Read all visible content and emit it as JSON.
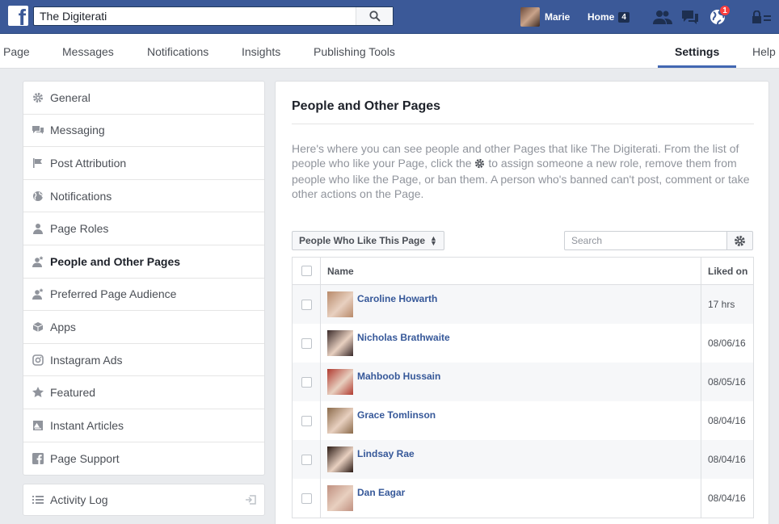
{
  "topbar": {
    "search_value": "The Digiterati",
    "user_name": "Marie",
    "home_label": "Home",
    "home_count": "4",
    "globe_badge": "1"
  },
  "pagenav": {
    "items": [
      "Page",
      "Messages",
      "Notifications",
      "Insights",
      "Publishing Tools",
      "Settings",
      "Help"
    ],
    "active": "Settings"
  },
  "sidebar": {
    "items": [
      {
        "label": "General",
        "icon": "gear-icon"
      },
      {
        "label": "Messaging",
        "icon": "chat-icon"
      },
      {
        "label": "Post Attribution",
        "icon": "flag-icon"
      },
      {
        "label": "Notifications",
        "icon": "globe-icon"
      },
      {
        "label": "Page Roles",
        "icon": "person-icon"
      },
      {
        "label": "People and Other Pages",
        "icon": "person-star-icon"
      },
      {
        "label": "Preferred Page Audience",
        "icon": "person-star-icon"
      },
      {
        "label": "Apps",
        "icon": "cube-icon"
      },
      {
        "label": "Instagram Ads",
        "icon": "instagram-icon"
      },
      {
        "label": "Featured",
        "icon": "star-icon"
      },
      {
        "label": "Instant Articles",
        "icon": "article-icon"
      },
      {
        "label": "Page Support",
        "icon": "facebook-icon"
      }
    ],
    "active": "People and Other Pages",
    "activity_log": "Activity Log"
  },
  "main": {
    "title": "People and Other Pages",
    "desc_part1": "Here's where you can see people and other Pages that like The Digiterati. From the list of people who like your Page, click the ",
    "desc_part2": " to assign someone a new role, remove them from people who like the Page, or ban them. A person who's banned can't post, comment or take other actions on the Page.",
    "dropdown_label": "People Who Like This Page",
    "search_placeholder": "Search",
    "table": {
      "col_name": "Name",
      "col_date": "Liked on",
      "rows": [
        {
          "name": "Caroline Howarth",
          "date": "17 hrs",
          "avatar": "#b88a6a"
        },
        {
          "name": "Nicholas Brathwaite",
          "date": "08/06/16",
          "avatar": "#3a2a2a"
        },
        {
          "name": "Mahboob Hussain",
          "date": "08/05/16",
          "avatar": "#b03a30"
        },
        {
          "name": "Grace Tomlinson",
          "date": "08/04/16",
          "avatar": "#8a6a4a"
        },
        {
          "name": "Lindsay Rae",
          "date": "08/04/16",
          "avatar": "#2a1a14"
        },
        {
          "name": "Dan Eagar",
          "date": "08/04/16",
          "avatar": "#c09080"
        }
      ]
    }
  }
}
